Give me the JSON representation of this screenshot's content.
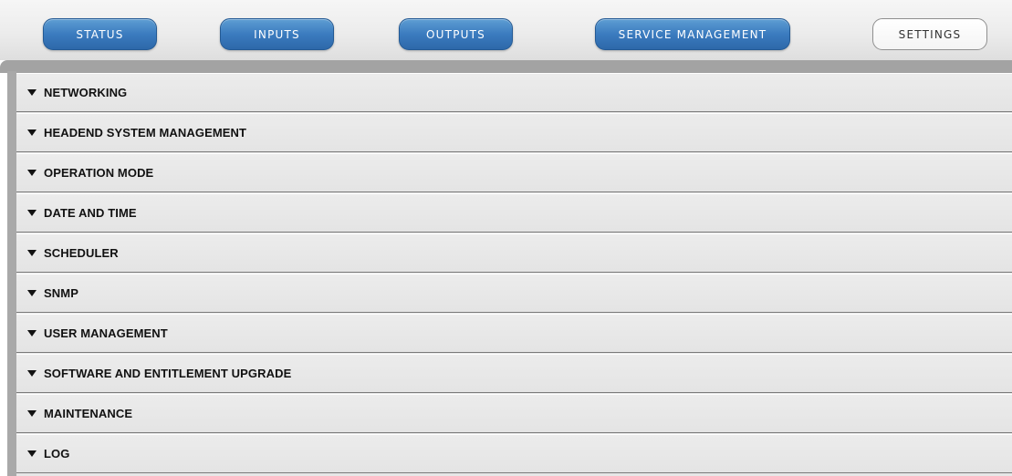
{
  "nav": {
    "status": "STATUS",
    "inputs": "INPUTS",
    "outputs": "OUTPUTS",
    "service_management": "SERVICE MANAGEMENT",
    "settings": "SETTINGS",
    "active_tab": "SETTINGS"
  },
  "colors": {
    "nav_blue": "#3b7bbf",
    "separator": "#a3a3a3",
    "row_background": "#e7e7e7"
  },
  "sections": [
    {
      "label": "NETWORKING",
      "icon": "triangle-down-icon"
    },
    {
      "label": "HEADEND SYSTEM MANAGEMENT",
      "icon": "triangle-down-icon"
    },
    {
      "label": "OPERATION MODE",
      "icon": "triangle-down-icon"
    },
    {
      "label": "DATE AND TIME",
      "icon": "triangle-down-icon"
    },
    {
      "label": "SCHEDULER",
      "icon": "triangle-down-icon"
    },
    {
      "label": "SNMP",
      "icon": "triangle-down-icon"
    },
    {
      "label": "USER MANAGEMENT",
      "icon": "triangle-down-icon"
    },
    {
      "label": "SOFTWARE AND ENTITLEMENT UPGRADE",
      "icon": "triangle-down-icon"
    },
    {
      "label": "MAINTENANCE",
      "icon": "triangle-down-icon"
    },
    {
      "label": "LOG",
      "icon": "triangle-down-icon"
    }
  ]
}
